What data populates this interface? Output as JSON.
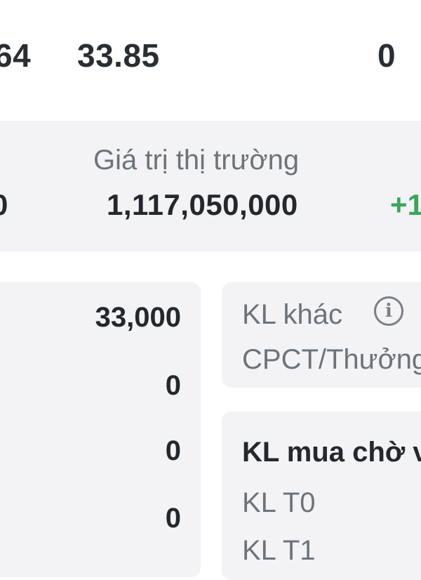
{
  "top_row": {
    "value_left_partial": "64",
    "value_mid": "33.85",
    "value_right": "0"
  },
  "market": {
    "label": "Giá trị thị trường",
    "value": "1,117,050,000",
    "left_partial": "0",
    "change_partial": "+1",
    "change_color": "#3aa65a"
  },
  "quantities": {
    "values": [
      "33,000",
      "0",
      "0",
      "0"
    ]
  },
  "other_qty": {
    "label": "KL khác",
    "sub_label": "CPCT/Thưởng",
    "icon": "info-icon"
  },
  "pending_buy": {
    "title": "KL mua chờ v",
    "rows": [
      "KL T0",
      "KL T1"
    ]
  }
}
